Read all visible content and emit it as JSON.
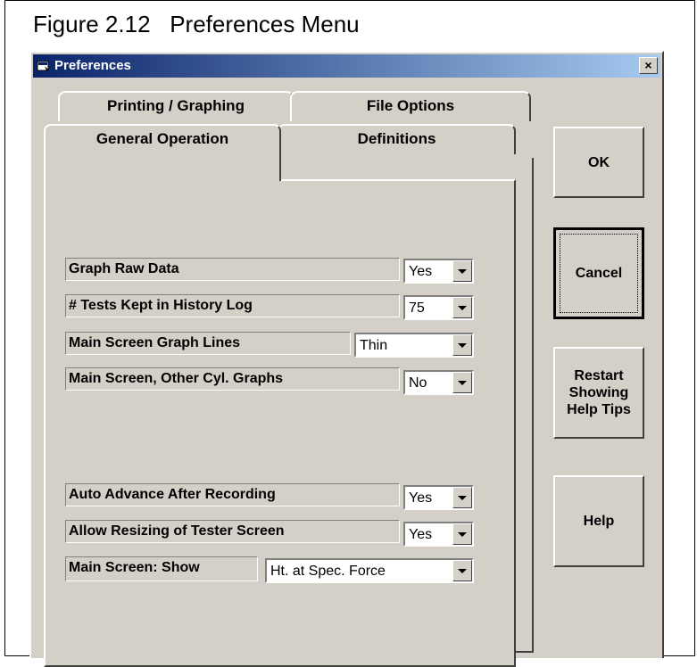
{
  "figure_caption": "Figure 2.12   Preferences Menu",
  "window": {
    "title": "Preferences",
    "close_label": "×"
  },
  "tabs": {
    "back": [
      "Printing / Graphing",
      "File Options"
    ],
    "front": [
      "General Operation",
      "Definitions"
    ],
    "active": "General Operation"
  },
  "settings": [
    {
      "label": "Graph Raw Data",
      "value": "Yes"
    },
    {
      "label": "# Tests Kept in History Log",
      "value": "75"
    },
    {
      "label": "Main Screen Graph Lines",
      "value": "Thin"
    },
    {
      "label": "Main Screen, Other Cyl. Graphs",
      "value": "No"
    },
    {
      "label": "Auto Advance After Recording",
      "value": "Yes"
    },
    {
      "label": "Allow Resizing of Tester Screen",
      "value": "Yes"
    },
    {
      "label": "Main Screen:  Show",
      "value": "Ht. at Spec. Force"
    }
  ],
  "buttons": {
    "ok": "OK",
    "cancel": "Cancel",
    "restart": [
      "Restart",
      "Showing",
      "Help Tips"
    ],
    "help": "Help"
  },
  "colors": {
    "title_start": "#0a246a",
    "title_end": "#a6caf0",
    "face": "#d4d0c8"
  }
}
